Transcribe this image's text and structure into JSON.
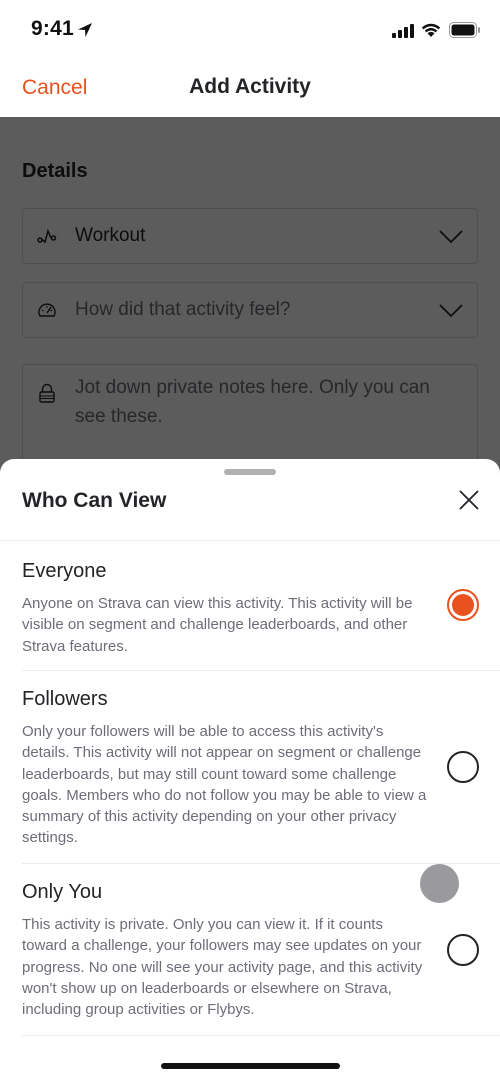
{
  "status_bar": {
    "time": "9:41",
    "icons": [
      "location-arrow-icon",
      "cellular-signal-icon",
      "wifi-icon",
      "battery-icon"
    ]
  },
  "nav": {
    "cancel_label": "Cancel",
    "title": "Add Activity"
  },
  "details": {
    "section_title": "Details",
    "activity_type": {
      "icon": "workout-icon",
      "value": "Workout"
    },
    "feel": {
      "icon": "gauge-icon",
      "placeholder": "How did that activity feel?"
    },
    "notes": {
      "icon": "lock-icon",
      "placeholder": "Jot down private notes here. Only you can see these."
    }
  },
  "sheet": {
    "title": "Who Can View",
    "close_icon": "close-icon",
    "selected": "everyone",
    "options": [
      {
        "id": "everyone",
        "title": "Everyone",
        "description": "Anyone on Strava can view this activity. This activity will be visible on segment and challenge leaderboards, and other Strava features.",
        "selected": true
      },
      {
        "id": "followers",
        "title": "Followers",
        "description": "Only your followers will be able to access this activity's details. This activity will not appear on segment or challenge leaderboards, but may still count toward some challenge goals. Members who do not follow you may be able to view a summary of this activity depending on your other privacy settings.",
        "selected": false
      },
      {
        "id": "only_you",
        "title": "Only You",
        "description": "This activity is private. Only you can view it. If it counts toward a challenge, your followers may see updates on your progress. No one will see your activity page, and this activity won't show up on leaderboards or elsewhere on Strava, including group activities or Flybys.",
        "selected": false
      }
    ]
  },
  "colors": {
    "accent": "#e9511f",
    "text_primary": "#242428",
    "text_secondary": "#6d6d78",
    "overlay": "#5b5a5e"
  }
}
